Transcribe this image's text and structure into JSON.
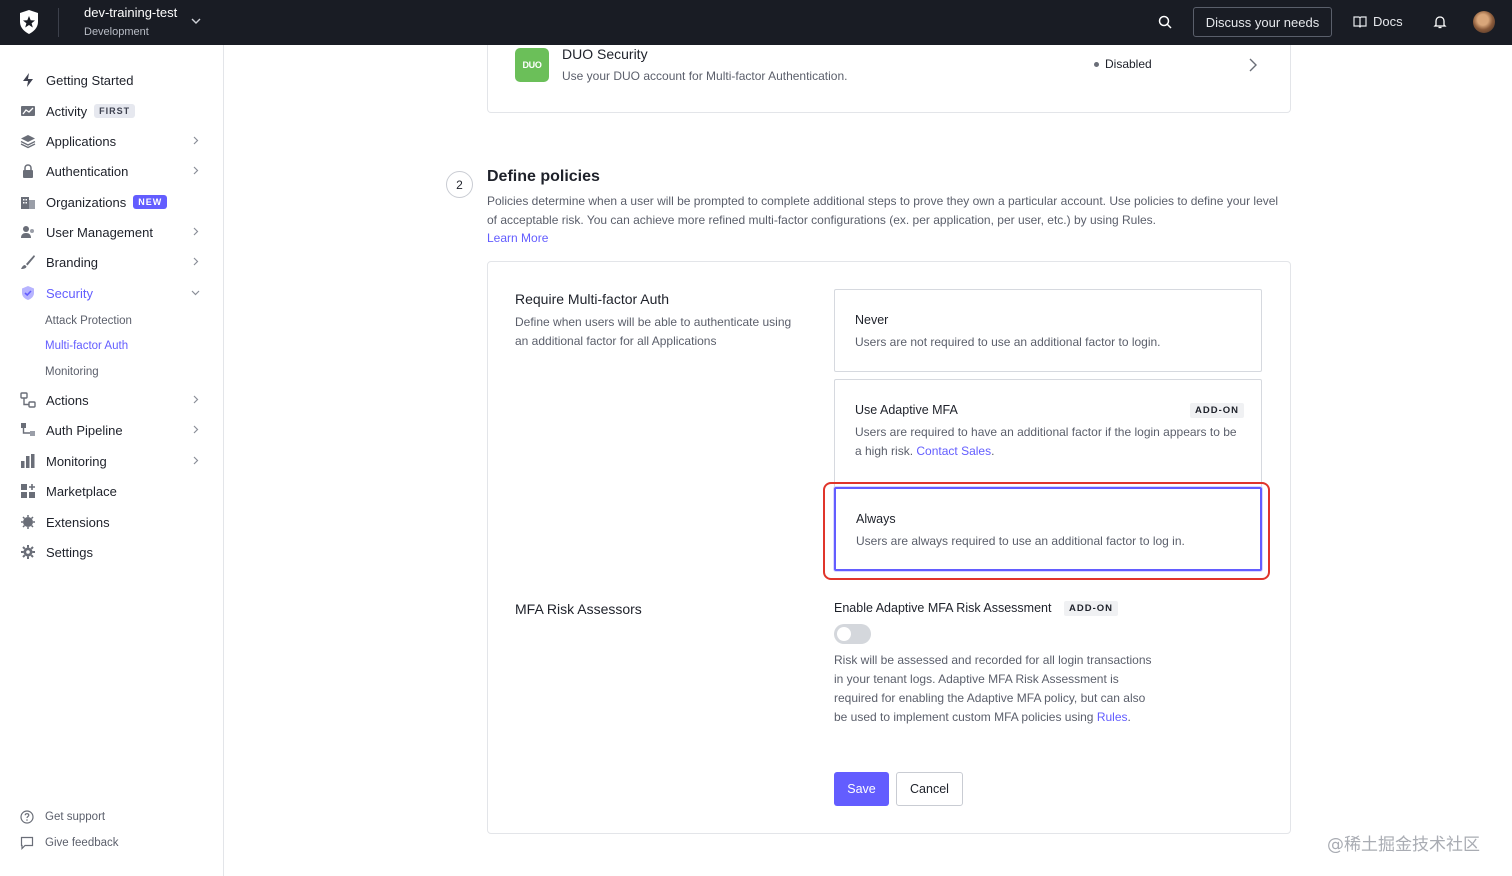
{
  "topbar": {
    "tenant_name": "dev-training-test",
    "tenant_env": "Development",
    "discuss_label": "Discuss your needs",
    "docs_label": "Docs"
  },
  "sidebar": {
    "items": [
      {
        "label": "Getting Started",
        "icon": "bolt-icon"
      },
      {
        "label": "Activity",
        "icon": "chart-icon",
        "badge": "FIRST"
      },
      {
        "label": "Applications",
        "icon": "layers-icon"
      },
      {
        "label": "Authentication",
        "icon": "lock-icon"
      },
      {
        "label": "Organizations",
        "icon": "building-icon",
        "badge": "NEW"
      },
      {
        "label": "User Management",
        "icon": "users-icon"
      },
      {
        "label": "Branding",
        "icon": "brush-icon"
      },
      {
        "label": "Security",
        "icon": "shield-check-icon"
      },
      {
        "label": "Actions",
        "icon": "flow-icon"
      },
      {
        "label": "Auth Pipeline",
        "icon": "pipeline-icon"
      },
      {
        "label": "Monitoring",
        "icon": "bar-chart-icon"
      },
      {
        "label": "Marketplace",
        "icon": "grid-plus-icon"
      },
      {
        "label": "Extensions",
        "icon": "puzzle-icon"
      },
      {
        "label": "Settings",
        "icon": "gear-icon"
      }
    ],
    "security_sub": [
      "Attack Protection",
      "Multi-factor Auth",
      "Monitoring"
    ],
    "footer": [
      "Get support",
      "Give feedback"
    ]
  },
  "duo": {
    "logo_text": "DUO",
    "title": "DUO Security",
    "desc": "Use your DUO account for Multi-factor Authentication.",
    "status": "Disabled"
  },
  "policies": {
    "step": "2",
    "title": "Define policies",
    "desc": "Policies determine when a user will be prompted to complete additional steps to prove they own a particular account. Use policies to define your level of acceptable risk. You can achieve more refined multi-factor configurations (ex. per application, per user, etc.) by using Rules.",
    "learn_more": "Learn More",
    "require_title": "Require Multi-factor Auth",
    "require_desc": "Define when users will be able to authenticate using an additional factor for all Applications",
    "options": [
      {
        "title": "Never",
        "desc": "Users are not required to use an additional factor to login."
      },
      {
        "title": "Use Adaptive MFA",
        "badge": "ADD-ON",
        "desc": "Users are required to have an additional factor if the login appears to be a high risk.",
        "link": "Contact Sales",
        "after": "."
      },
      {
        "title": "Always",
        "desc": "Users are always required to use an additional factor to log in."
      }
    ],
    "selected": "Always",
    "risk_title": "MFA Risk Assessors",
    "risk_label": "Enable Adaptive MFA Risk Assessment",
    "risk_badge": "ADD-ON",
    "risk_enabled": false,
    "risk_desc": "Risk will be assessed and recorded for all login transactions in your tenant logs. Adaptive MFA Risk Assessment is required for enabling the Adaptive MFA policy, but can also be used to implement custom MFA policies using",
    "risk_link": "Rules",
    "risk_after": ".",
    "save_label": "Save",
    "cancel_label": "Cancel"
  },
  "watermark": "@稀土掘金技术社区",
  "colors": {
    "accent": "#635dff",
    "topbar": "#191c24",
    "highlight": "#e0352b",
    "duo_green": "#6bbf59"
  }
}
